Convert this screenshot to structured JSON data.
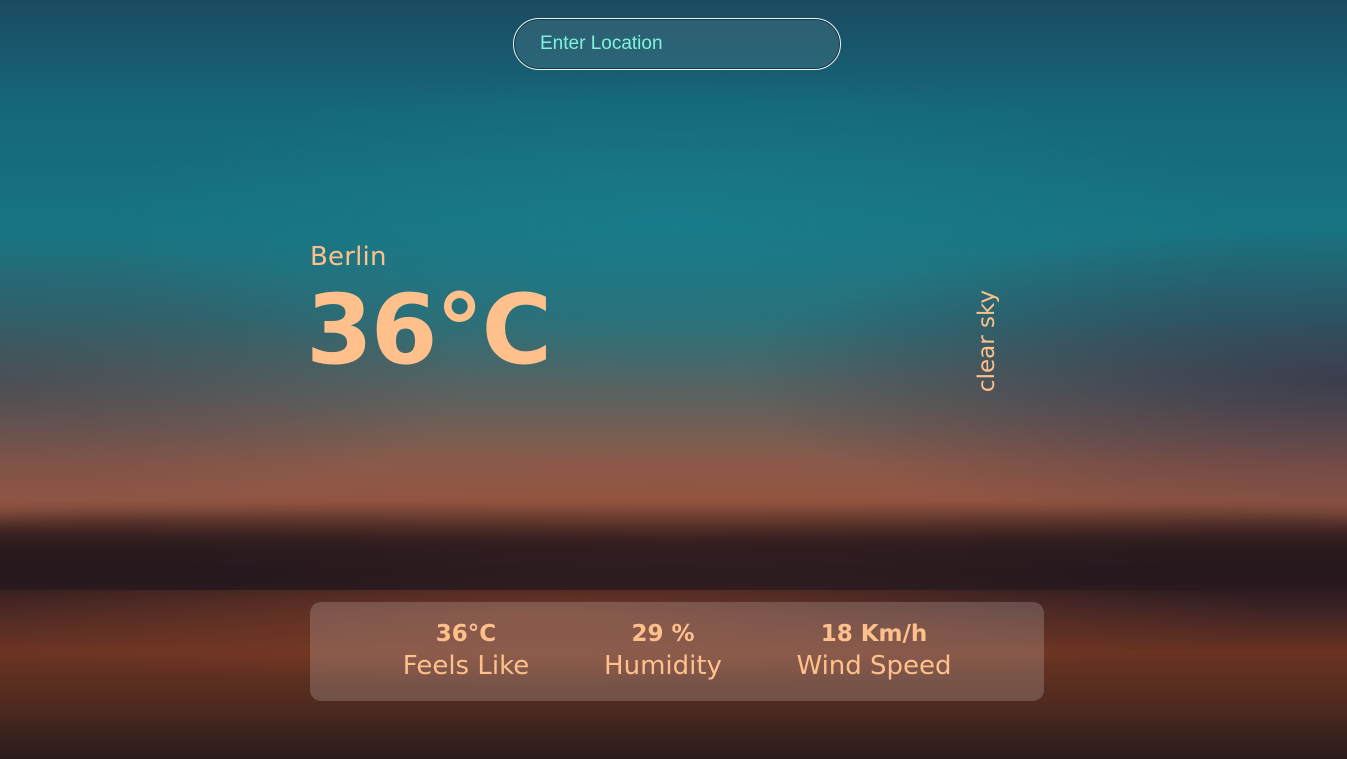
{
  "search": {
    "placeholder": "Enter Location",
    "value": ""
  },
  "weather": {
    "city": "Berlin",
    "temperature": "36°C",
    "description": "clear sky"
  },
  "stats": {
    "feels_like": {
      "value": "36°C",
      "label": "Feels Like"
    },
    "humidity": {
      "value": "29 %",
      "label": "Humidity"
    },
    "wind_speed": {
      "value": "18 Km/h",
      "label": "Wind Speed"
    }
  },
  "colors": {
    "accent_text": "#ffc08c",
    "input_text": "#7ff3de"
  }
}
